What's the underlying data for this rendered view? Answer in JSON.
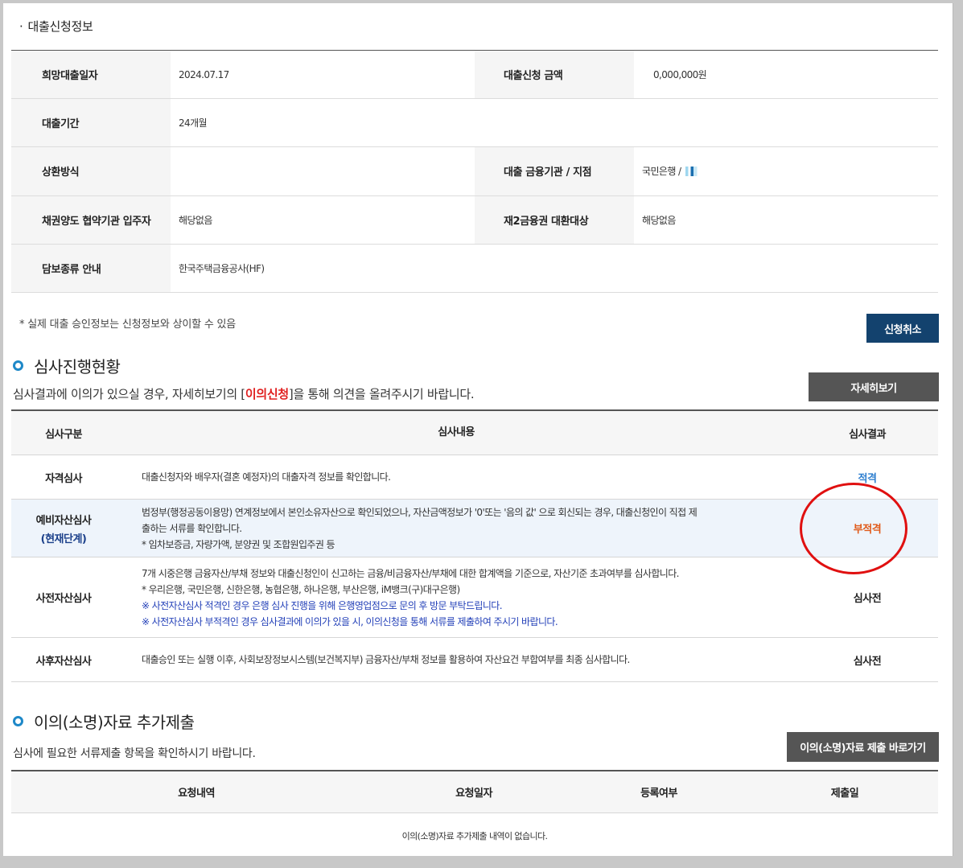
{
  "loan_info": {
    "section_title": "대출신청정보",
    "rows": [
      {
        "label1": "희망대출일자",
        "value1": "2024.07.17",
        "label2": "대출신청 금액",
        "value2": "0,000,000원"
      },
      {
        "label1": "대출기간",
        "value1": "24개월"
      },
      {
        "label1": "상환방식",
        "value1": "",
        "label2": "대출 금융기관 / 지점",
        "value2": "국민은행 /"
      },
      {
        "label1": "채권양도 협약기관 입주자",
        "value1": "해당없음",
        "label2": "재2금융권 대환대상",
        "value2": "해당없음"
      },
      {
        "label1": "담보종류 안내",
        "value1": "한국주택금융공사(HF)"
      }
    ],
    "note": "* 실제 대출 승인정보는 신청정보와 상이할 수 있음",
    "cancel_button": "신청취소"
  },
  "review": {
    "heading": "심사진행현황",
    "desc_before": "심사결과에 이의가 있으실 경우, 자세히보기의 [",
    "desc_highlight": "이의신청",
    "desc_after": "]을 통해 의견을 올려주시기 바랍니다.",
    "detail_button": "자세히보기",
    "headers": [
      "심사구분",
      "심사내용",
      "심사결과"
    ],
    "rows": [
      {
        "type": "자격심사",
        "lines": [
          "대출신청자와 배우자(결혼 예정자)의 대출자격 정보를 확인합니다."
        ],
        "result": "적격"
      },
      {
        "type": "예비자산심사",
        "stage": "(현재단계)",
        "lines": [
          "범정부(행정공동이용망) 연계정보에서 본인소유자산으로 확인되었으나, 자산금액정보가 '0'또는 '음의 값' 으로 회신되는 경우, 대출신청인이 직접 제",
          "출하는 서류를 확인합니다.",
          "* 임차보증금, 자량가액, 분양권 및 조합원입주권 등"
        ],
        "result": "부적격"
      },
      {
        "type": "사전자산심사",
        "lines": [
          "7개 시중은행 금융자산/부채 정보와 대출신청인이 신고하는 금융/비금융자산/부채에 대한 합계액을 기준으로, 자산기준 초과여부를 심사합니다.",
          "* 우리은행, 국민은행, 신한은행, 농협은행, 하나은행, 부산은행, iM뱅크(구)대구은행)",
          "※ 사전자산심사 적격인 경우 은행 심사 진행을 위해 은행영업점으로 문의 후 방문 부탁드립니다.",
          "※ 사전자산심사 부적격인 경우 심사결과에 이의가 있을 시, 이의신청을 통해 서류를 제출하여 주시기 바랍니다."
        ],
        "result": "심사전"
      },
      {
        "type": "사후자산심사",
        "lines": [
          "대출승인 또는 실행 이후, 사회보장정보시스템(보건복지부) 금융자산/부채 정보를 활용하여 자산요건 부합여부를 최종 심사합니다."
        ],
        "result": "심사전"
      }
    ]
  },
  "supplement": {
    "heading": "이의(소명)자료 추가제출",
    "desc": "심사에 필요한 서류제출 항목을 확인하시기 바랍니다.",
    "goto_button": "이의(소명)자료 제출  바로가기",
    "headers": [
      "요청내역",
      "요청일자",
      "등록여부",
      "제출일"
    ],
    "empty_text": "이의(소명)자료 추가제출 내역이 없습니다."
  },
  "colors": {
    "navy_button": "#13426e",
    "gray_button": "#555555",
    "pass": "#2f7fcf",
    "fail": "#e05a1a",
    "annotation_circle": "#e01010",
    "highlight_red": "#e02020"
  }
}
